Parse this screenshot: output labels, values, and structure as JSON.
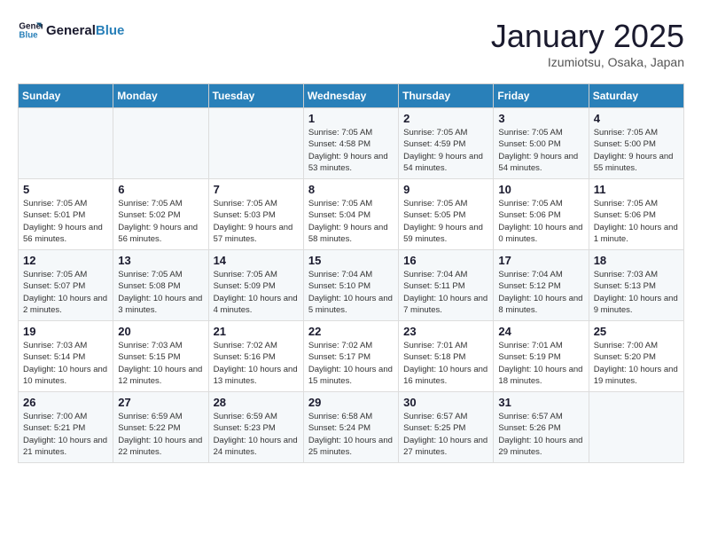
{
  "header": {
    "logo_line1": "General",
    "logo_line2": "Blue",
    "month_title": "January 2025",
    "location": "Izumiotsu, Osaka, Japan"
  },
  "weekdays": [
    "Sunday",
    "Monday",
    "Tuesday",
    "Wednesday",
    "Thursday",
    "Friday",
    "Saturday"
  ],
  "weeks": [
    [
      {
        "day": "",
        "sunrise": "",
        "sunset": "",
        "daylight": ""
      },
      {
        "day": "",
        "sunrise": "",
        "sunset": "",
        "daylight": ""
      },
      {
        "day": "",
        "sunrise": "",
        "sunset": "",
        "daylight": ""
      },
      {
        "day": "1",
        "sunrise": "Sunrise: 7:05 AM",
        "sunset": "Sunset: 4:58 PM",
        "daylight": "Daylight: 9 hours and 53 minutes."
      },
      {
        "day": "2",
        "sunrise": "Sunrise: 7:05 AM",
        "sunset": "Sunset: 4:59 PM",
        "daylight": "Daylight: 9 hours and 54 minutes."
      },
      {
        "day": "3",
        "sunrise": "Sunrise: 7:05 AM",
        "sunset": "Sunset: 5:00 PM",
        "daylight": "Daylight: 9 hours and 54 minutes."
      },
      {
        "day": "4",
        "sunrise": "Sunrise: 7:05 AM",
        "sunset": "Sunset: 5:00 PM",
        "daylight": "Daylight: 9 hours and 55 minutes."
      }
    ],
    [
      {
        "day": "5",
        "sunrise": "Sunrise: 7:05 AM",
        "sunset": "Sunset: 5:01 PM",
        "daylight": "Daylight: 9 hours and 56 minutes."
      },
      {
        "day": "6",
        "sunrise": "Sunrise: 7:05 AM",
        "sunset": "Sunset: 5:02 PM",
        "daylight": "Daylight: 9 hours and 56 minutes."
      },
      {
        "day": "7",
        "sunrise": "Sunrise: 7:05 AM",
        "sunset": "Sunset: 5:03 PM",
        "daylight": "Daylight: 9 hours and 57 minutes."
      },
      {
        "day": "8",
        "sunrise": "Sunrise: 7:05 AM",
        "sunset": "Sunset: 5:04 PM",
        "daylight": "Daylight: 9 hours and 58 minutes."
      },
      {
        "day": "9",
        "sunrise": "Sunrise: 7:05 AM",
        "sunset": "Sunset: 5:05 PM",
        "daylight": "Daylight: 9 hours and 59 minutes."
      },
      {
        "day": "10",
        "sunrise": "Sunrise: 7:05 AM",
        "sunset": "Sunset: 5:06 PM",
        "daylight": "Daylight: 10 hours and 0 minutes."
      },
      {
        "day": "11",
        "sunrise": "Sunrise: 7:05 AM",
        "sunset": "Sunset: 5:06 PM",
        "daylight": "Daylight: 10 hours and 1 minute."
      }
    ],
    [
      {
        "day": "12",
        "sunrise": "Sunrise: 7:05 AM",
        "sunset": "Sunset: 5:07 PM",
        "daylight": "Daylight: 10 hours and 2 minutes."
      },
      {
        "day": "13",
        "sunrise": "Sunrise: 7:05 AM",
        "sunset": "Sunset: 5:08 PM",
        "daylight": "Daylight: 10 hours and 3 minutes."
      },
      {
        "day": "14",
        "sunrise": "Sunrise: 7:05 AM",
        "sunset": "Sunset: 5:09 PM",
        "daylight": "Daylight: 10 hours and 4 minutes."
      },
      {
        "day": "15",
        "sunrise": "Sunrise: 7:04 AM",
        "sunset": "Sunset: 5:10 PM",
        "daylight": "Daylight: 10 hours and 5 minutes."
      },
      {
        "day": "16",
        "sunrise": "Sunrise: 7:04 AM",
        "sunset": "Sunset: 5:11 PM",
        "daylight": "Daylight: 10 hours and 7 minutes."
      },
      {
        "day": "17",
        "sunrise": "Sunrise: 7:04 AM",
        "sunset": "Sunset: 5:12 PM",
        "daylight": "Daylight: 10 hours and 8 minutes."
      },
      {
        "day": "18",
        "sunrise": "Sunrise: 7:03 AM",
        "sunset": "Sunset: 5:13 PM",
        "daylight": "Daylight: 10 hours and 9 minutes."
      }
    ],
    [
      {
        "day": "19",
        "sunrise": "Sunrise: 7:03 AM",
        "sunset": "Sunset: 5:14 PM",
        "daylight": "Daylight: 10 hours and 10 minutes."
      },
      {
        "day": "20",
        "sunrise": "Sunrise: 7:03 AM",
        "sunset": "Sunset: 5:15 PM",
        "daylight": "Daylight: 10 hours and 12 minutes."
      },
      {
        "day": "21",
        "sunrise": "Sunrise: 7:02 AM",
        "sunset": "Sunset: 5:16 PM",
        "daylight": "Daylight: 10 hours and 13 minutes."
      },
      {
        "day": "22",
        "sunrise": "Sunrise: 7:02 AM",
        "sunset": "Sunset: 5:17 PM",
        "daylight": "Daylight: 10 hours and 15 minutes."
      },
      {
        "day": "23",
        "sunrise": "Sunrise: 7:01 AM",
        "sunset": "Sunset: 5:18 PM",
        "daylight": "Daylight: 10 hours and 16 minutes."
      },
      {
        "day": "24",
        "sunrise": "Sunrise: 7:01 AM",
        "sunset": "Sunset: 5:19 PM",
        "daylight": "Daylight: 10 hours and 18 minutes."
      },
      {
        "day": "25",
        "sunrise": "Sunrise: 7:00 AM",
        "sunset": "Sunset: 5:20 PM",
        "daylight": "Daylight: 10 hours and 19 minutes."
      }
    ],
    [
      {
        "day": "26",
        "sunrise": "Sunrise: 7:00 AM",
        "sunset": "Sunset: 5:21 PM",
        "daylight": "Daylight: 10 hours and 21 minutes."
      },
      {
        "day": "27",
        "sunrise": "Sunrise: 6:59 AM",
        "sunset": "Sunset: 5:22 PM",
        "daylight": "Daylight: 10 hours and 22 minutes."
      },
      {
        "day": "28",
        "sunrise": "Sunrise: 6:59 AM",
        "sunset": "Sunset: 5:23 PM",
        "daylight": "Daylight: 10 hours and 24 minutes."
      },
      {
        "day": "29",
        "sunrise": "Sunrise: 6:58 AM",
        "sunset": "Sunset: 5:24 PM",
        "daylight": "Daylight: 10 hours and 25 minutes."
      },
      {
        "day": "30",
        "sunrise": "Sunrise: 6:57 AM",
        "sunset": "Sunset: 5:25 PM",
        "daylight": "Daylight: 10 hours and 27 minutes."
      },
      {
        "day": "31",
        "sunrise": "Sunrise: 6:57 AM",
        "sunset": "Sunset: 5:26 PM",
        "daylight": "Daylight: 10 hours and 29 minutes."
      },
      {
        "day": "",
        "sunrise": "",
        "sunset": "",
        "daylight": ""
      }
    ]
  ]
}
